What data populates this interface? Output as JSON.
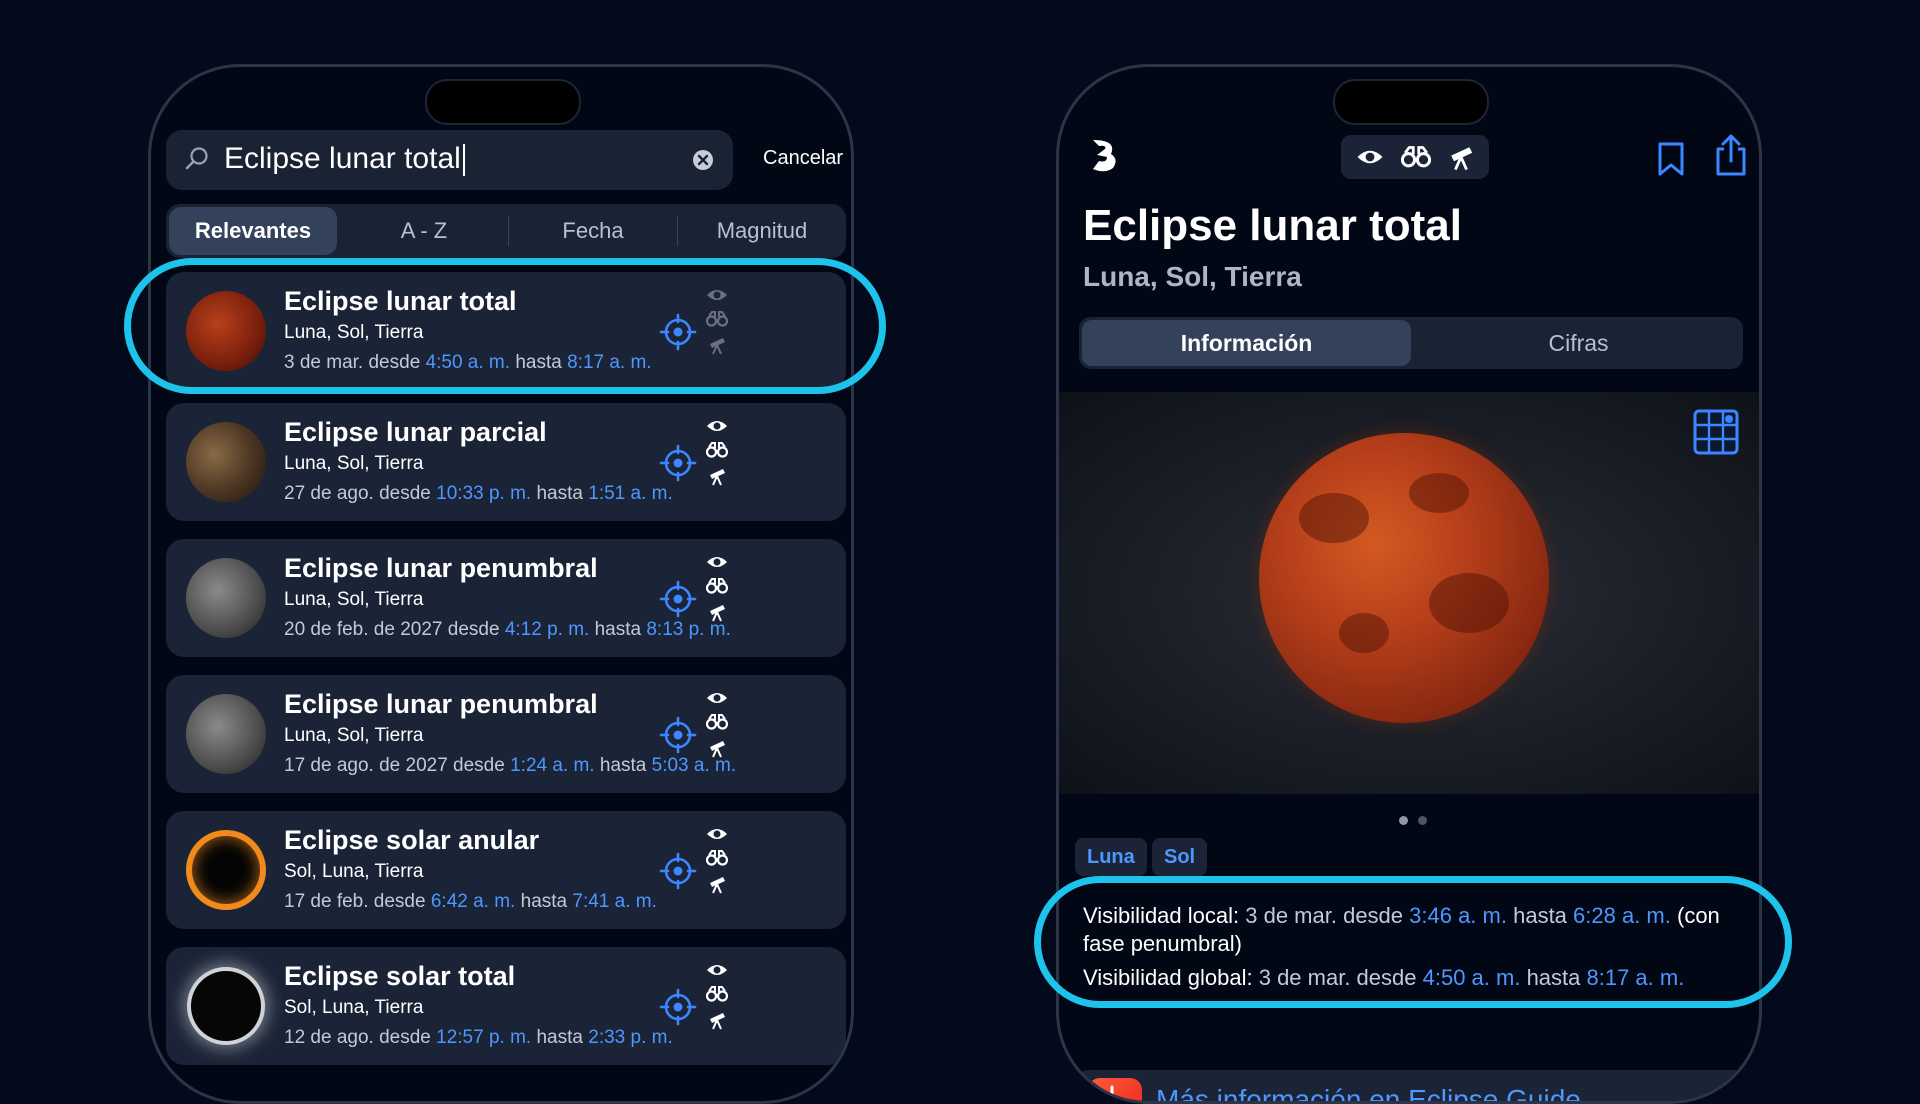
{
  "left": {
    "search": {
      "value": "Eclipse lunar total",
      "cancel_label": "Cancelar"
    },
    "sort_tabs": [
      "Relevantes",
      "A - Z",
      "Fecha",
      "Magnitud"
    ],
    "results": [
      {
        "title": "Eclipse lunar total",
        "bodies": "Luna, Sol, Tierra",
        "date": "3 de mar. desde ",
        "start": "4:50 a. m.",
        "mid": " hasta ",
        "end": "8:17 a. m.",
        "thumb": "blood-moon"
      },
      {
        "title": "Eclipse lunar parcial",
        "bodies": "Luna, Sol, Tierra",
        "date": "27 de ago. desde ",
        "start": "10:33 p. m.",
        "mid": " hasta ",
        "end": "1:51 a. m.",
        "thumb": "partial-moon"
      },
      {
        "title": "Eclipse lunar penumbral",
        "bodies": "Luna, Sol, Tierra",
        "date": "20 de feb. de 2027 desde ",
        "start": "4:12 p. m.",
        "mid": " hasta ",
        "end": "8:13 p. m.",
        "thumb": "grey-moon"
      },
      {
        "title": "Eclipse lunar penumbral",
        "bodies": "Luna, Sol, Tierra",
        "date": "17 de ago. de 2027 desde ",
        "start": "1:24 a. m.",
        "mid": " hasta ",
        "end": "5:03 a. m.",
        "thumb": "grey-moon"
      },
      {
        "title": "Eclipse solar anular",
        "bodies": "Sol, Luna, Tierra",
        "date": "17 de feb. desde ",
        "start": "6:42 a. m.",
        "mid": " hasta ",
        "end": "7:41 a. m.",
        "thumb": "ring-of-fire"
      },
      {
        "title": "Eclipse solar total",
        "bodies": "Sol, Luna, Tierra",
        "date": "12 de ago. desde ",
        "start": "12:57 p. m.",
        "mid": " hasta ",
        "end": "2:33 p. m.",
        "thumb": "corona"
      }
    ]
  },
  "right": {
    "title": "Eclipse lunar total",
    "subtitle": "Luna, Sol, Tierra",
    "tabs": [
      "Información",
      "Cifras"
    ],
    "tags": [
      "Luna",
      "Sol"
    ],
    "local": {
      "label": "Visibilidad local:",
      "pre": " 3 de mar. desde ",
      "start": "3:46 a. m.",
      "mid": " hasta ",
      "end": "6:28 a. m.",
      "post": " (con fase penumbral)"
    },
    "global": {
      "label": "Visibilidad global:",
      "pre": " 3 de mar. desde ",
      "start": "4:50 a. m.",
      "mid": " hasta ",
      "end": "8:17 a. m."
    },
    "more_info": "Más información en Eclipse Guide"
  },
  "colors": {
    "accent": "#4d97ff",
    "highlight": "#1ec3ec",
    "background": "#030a1c"
  }
}
